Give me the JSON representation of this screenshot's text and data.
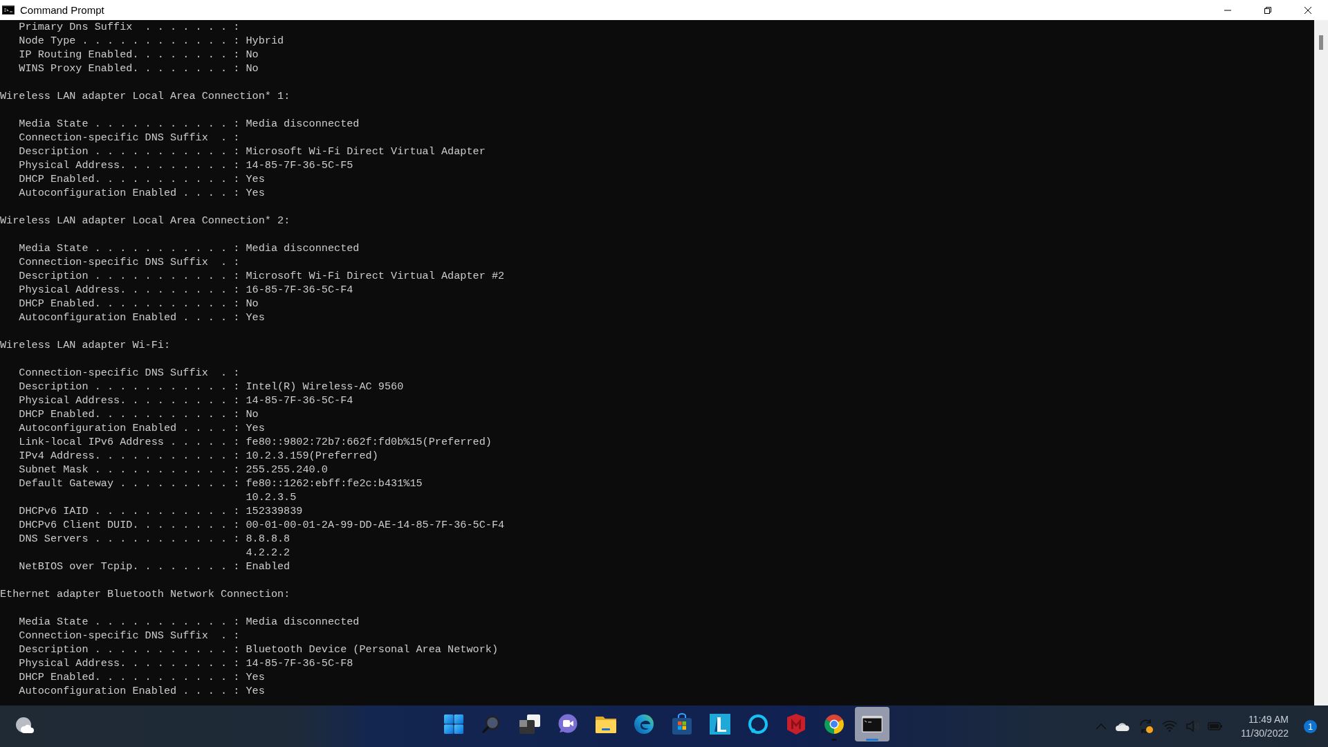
{
  "window": {
    "title": "Command Prompt"
  },
  "console": {
    "sections": [
      {
        "lines": [
          {
            "kind": "entry",
            "text": "Primary Dns Suffix  . . . . . . . :"
          },
          {
            "kind": "entry",
            "text": "Node Type . . . . . . . . . . . . : Hybrid"
          },
          {
            "kind": "entry",
            "text": "IP Routing Enabled. . . . . . . . : No"
          },
          {
            "kind": "entry",
            "text": "WINS Proxy Enabled. . . . . . . . : No"
          }
        ]
      },
      {
        "heading": "Wireless LAN adapter Local Area Connection* 1:",
        "lines": [
          {
            "kind": "entry",
            "text": "Media State . . . . . . . . . . . : Media disconnected"
          },
          {
            "kind": "entry",
            "text": "Connection-specific DNS Suffix  . :"
          },
          {
            "kind": "entry",
            "text": "Description . . . . . . . . . . . : Microsoft Wi-Fi Direct Virtual Adapter"
          },
          {
            "kind": "entry",
            "text": "Physical Address. . . . . . . . . : 14-85-7F-36-5C-F5"
          },
          {
            "kind": "entry",
            "text": "DHCP Enabled. . . . . . . . . . . : Yes"
          },
          {
            "kind": "entry",
            "text": "Autoconfiguration Enabled . . . . : Yes"
          }
        ]
      },
      {
        "heading": "Wireless LAN adapter Local Area Connection* 2:",
        "lines": [
          {
            "kind": "entry",
            "text": "Media State . . . . . . . . . . . : Media disconnected"
          },
          {
            "kind": "entry",
            "text": "Connection-specific DNS Suffix  . :"
          },
          {
            "kind": "entry",
            "text": "Description . . . . . . . . . . . : Microsoft Wi-Fi Direct Virtual Adapter #2"
          },
          {
            "kind": "entry",
            "text": "Physical Address. . . . . . . . . : 16-85-7F-36-5C-F4"
          },
          {
            "kind": "entry",
            "text": "DHCP Enabled. . . . . . . . . . . : No"
          },
          {
            "kind": "entry",
            "text": "Autoconfiguration Enabled . . . . : Yes"
          }
        ]
      },
      {
        "heading": "Wireless LAN adapter Wi-Fi:",
        "lines": [
          {
            "kind": "entry",
            "text": "Connection-specific DNS Suffix  . :"
          },
          {
            "kind": "entry",
            "text": "Description . . . . . . . . . . . : Intel(R) Wireless-AC 9560"
          },
          {
            "kind": "entry",
            "text": "Physical Address. . . . . . . . . : 14-85-7F-36-5C-F4"
          },
          {
            "kind": "entry",
            "text": "DHCP Enabled. . . . . . . . . . . : No"
          },
          {
            "kind": "entry",
            "text": "Autoconfiguration Enabled . . . . : Yes"
          },
          {
            "kind": "entry",
            "text": "Link-local IPv6 Address . . . . . : fe80::9802:72b7:662f:fd0b%15(Preferred)"
          },
          {
            "kind": "entry",
            "text": "IPv4 Address. . . . . . . . . . . : 10.2.3.159(Preferred)"
          },
          {
            "kind": "entry",
            "text": "Subnet Mask . . . . . . . . . . . : 255.255.240.0"
          },
          {
            "kind": "entry",
            "text": "Default Gateway . . . . . . . . . : fe80::1262:ebff:fe2c:b431%15"
          },
          {
            "kind": "continuation",
            "text": "10.2.3.5"
          },
          {
            "kind": "entry",
            "text": "DHCPv6 IAID . . . . . . . . . . . : 152339839"
          },
          {
            "kind": "entry",
            "text": "DHCPv6 Client DUID. . . . . . . . : 00-01-00-01-2A-99-DD-AE-14-85-7F-36-5C-F4"
          },
          {
            "kind": "entry",
            "text": "DNS Servers . . . . . . . . . . . : 8.8.8.8"
          },
          {
            "kind": "continuation",
            "text": "4.2.2.2"
          },
          {
            "kind": "entry",
            "text": "NetBIOS over Tcpip. . . . . . . . : Enabled"
          }
        ]
      },
      {
        "heading": "Ethernet adapter Bluetooth Network Connection:",
        "lines": [
          {
            "kind": "entry",
            "text": "Media State . . . . . . . . . . . : Media disconnected"
          },
          {
            "kind": "entry",
            "text": "Connection-specific DNS Suffix  . :"
          },
          {
            "kind": "entry",
            "text": "Description . . . . . . . . . . . : Bluetooth Device (Personal Area Network)"
          },
          {
            "kind": "entry",
            "text": "Physical Address. . . . . . . . . : 14-85-7F-36-5C-F8"
          },
          {
            "kind": "entry",
            "text": "DHCP Enabled. . . . . . . . . . . : Yes"
          },
          {
            "kind": "entry",
            "text": "Autoconfiguration Enabled . . . . : Yes"
          }
        ]
      }
    ]
  },
  "taskbar": {
    "apps": [
      {
        "kind": "start",
        "selected": false,
        "running": false
      },
      {
        "kind": "search",
        "selected": false,
        "running": false
      },
      {
        "kind": "taskview",
        "selected": false,
        "running": false
      },
      {
        "kind": "chat",
        "selected": false,
        "running": false
      },
      {
        "kind": "folder",
        "selected": false,
        "running": false
      },
      {
        "kind": "edge",
        "selected": false,
        "running": false
      },
      {
        "kind": "store",
        "selected": false,
        "running": false
      },
      {
        "kind": "lapp",
        "selected": false,
        "running": false
      },
      {
        "kind": "ring",
        "selected": false,
        "running": false
      },
      {
        "kind": "shield",
        "selected": false,
        "running": false
      },
      {
        "kind": "chrome",
        "selected": false,
        "running": true
      },
      {
        "kind": "terminal",
        "selected": true,
        "running": true
      }
    ],
    "clock": {
      "time": "11:49 AM",
      "date": "11/30/2022"
    },
    "notifications": "1"
  }
}
